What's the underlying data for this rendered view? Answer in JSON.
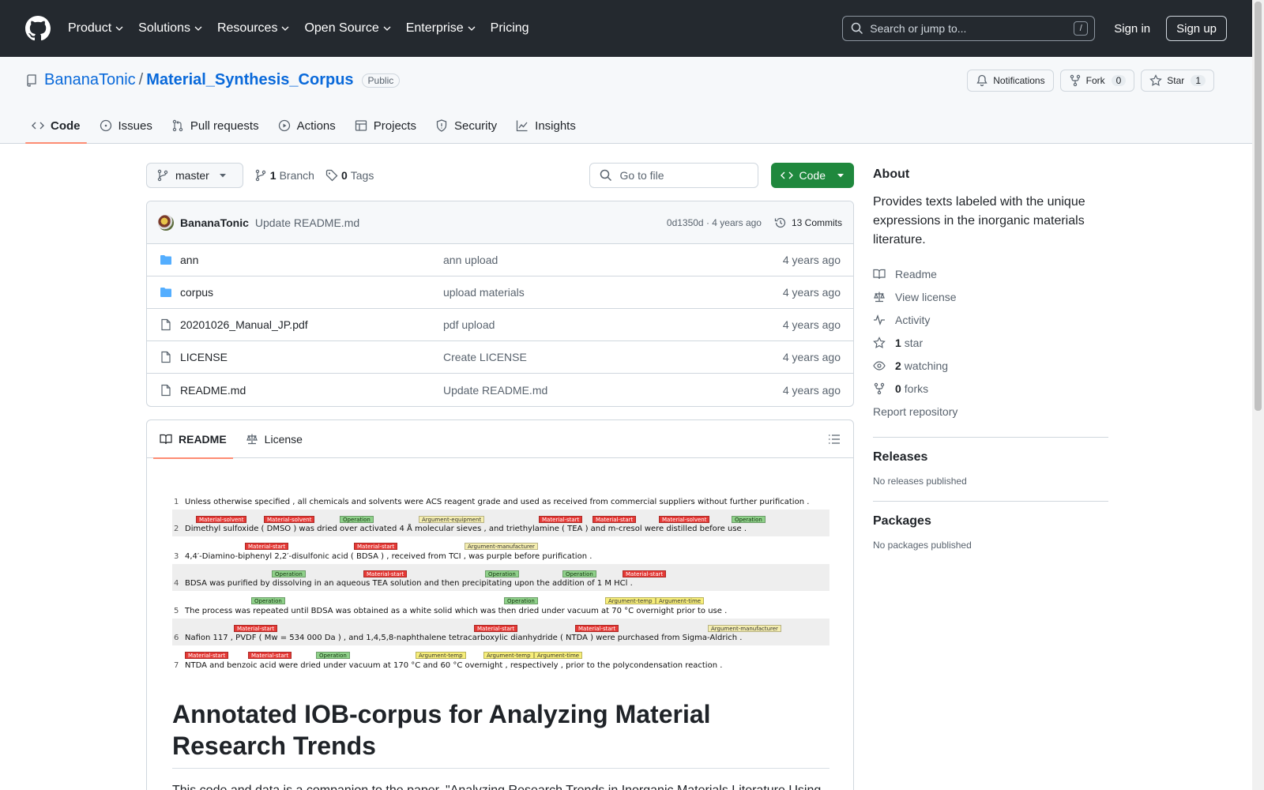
{
  "header": {
    "nav": [
      "Product",
      "Solutions",
      "Resources",
      "Open Source",
      "Enterprise",
      "Pricing"
    ],
    "search_placeholder": "Search or jump to...",
    "search_key": "/",
    "signin": "Sign in",
    "signup": "Sign up"
  },
  "repo": {
    "owner": "BananaTonic",
    "sep": "/",
    "name": "Material_Synthesis_Corpus",
    "visibility": "Public",
    "notifications": "Notifications",
    "fork_label": "Fork",
    "fork_count": "0",
    "star_label": "Star",
    "star_count": "1",
    "tabs": [
      "Code",
      "Issues",
      "Pull requests",
      "Actions",
      "Projects",
      "Security",
      "Insights"
    ]
  },
  "toolbar": {
    "branch": "master",
    "branch_count": "1",
    "branch_label": "Branch",
    "tag_count": "0",
    "tag_label": "Tags",
    "goto_placeholder": "Go to file",
    "code_button": "Code"
  },
  "commit": {
    "author": "BananaTonic",
    "message": "Update README.md",
    "meta": "0d1350d · 4 years ago",
    "commits": "13 Commits"
  },
  "files": [
    {
      "name": "ann",
      "type": "folder",
      "message": "ann upload",
      "date": "4 years ago"
    },
    {
      "name": "corpus",
      "type": "folder",
      "message": "upload materials",
      "date": "4 years ago"
    },
    {
      "name": "20201026_Manual_JP.pdf",
      "type": "file",
      "message": "pdf upload",
      "date": "4 years ago"
    },
    {
      "name": "LICENSE",
      "type": "file",
      "message": "Create LICENSE",
      "date": "4 years ago"
    },
    {
      "name": "README.md",
      "type": "file",
      "message": "Update README.md",
      "date": "4 years ago"
    }
  ],
  "readme": {
    "tabs": [
      "README",
      "License"
    ],
    "annotation_lines": [
      "Unless otherwise specified , all chemicals and solvents were ACS reagent grade and used as received from commercial suppliers without further purification .",
      "Dimethyl sulfoxide (      DMSO      ) was    dried    over activated 4 Å molecular sieves , and triethylamine (      TEA       ) and    m-cresol     were distilled  before use .",
      "4,4′-Diamino-biphenyl 2,2′-disulfonic acid (     BDSA      ) , received from              TCI             , was purple before purification .",
      "BDSA was purified by dissolving in an aqueous       TEA       solution and then precipitating upon the addition of 1 M       HCl        .",
      "The process was repeated until BDSA was obtained as a white solid which was then    dried    under vacuum at      70 °C       overnight    prior to use .",
      "Nafion 117 ,      PVDF      ( Mw = 534 000 Da ) , and 1,4,5,8-naphthalene tetracarboxylic dianhydride (     NTDA      ) were purchased from     Sigma-Aldrich       .",
      "   NTDA       and benzoic acid were    dried    under vacuum at      170 °C       and      60 °C        overnight    , respectively , prior to the polycondensation reaction ."
    ],
    "tag_labels": {
      "material_solvent": "Material-solvent",
      "material_start": "Material-start",
      "operation": "Operation",
      "argument_equipment": "Argument-equipment",
      "argument_manufacturer": "Argument-manufacturer",
      "argument_temp": "Argument-temp",
      "argument_time": "Argument-time"
    },
    "heading": "Annotated IOB-corpus for Analyzing Material Research Trends",
    "intro": "This code and data is a companion to the paper, \"Analyzing Research Trends in Inorganic Materials Literature Using"
  },
  "about": {
    "title": "About",
    "description": "Provides texts labeled with the unique expressions in the inorganic materials literature.",
    "readme": "Readme",
    "license": "View license",
    "activity": "Activity",
    "stars_count": "1",
    "stars_label": "star",
    "watching_count": "2",
    "watching_label": "watching",
    "forks_count": "0",
    "forks_label": "forks",
    "report": "Report repository"
  },
  "releases": {
    "title": "Releases",
    "empty": "No releases published"
  },
  "packages": {
    "title": "Packages",
    "empty": "No packages published"
  },
  "colors": {
    "accent": "#0969da",
    "header_bg": "#24292f",
    "code_green": "#1f883d",
    "tab_underline": "#fd8c73"
  }
}
